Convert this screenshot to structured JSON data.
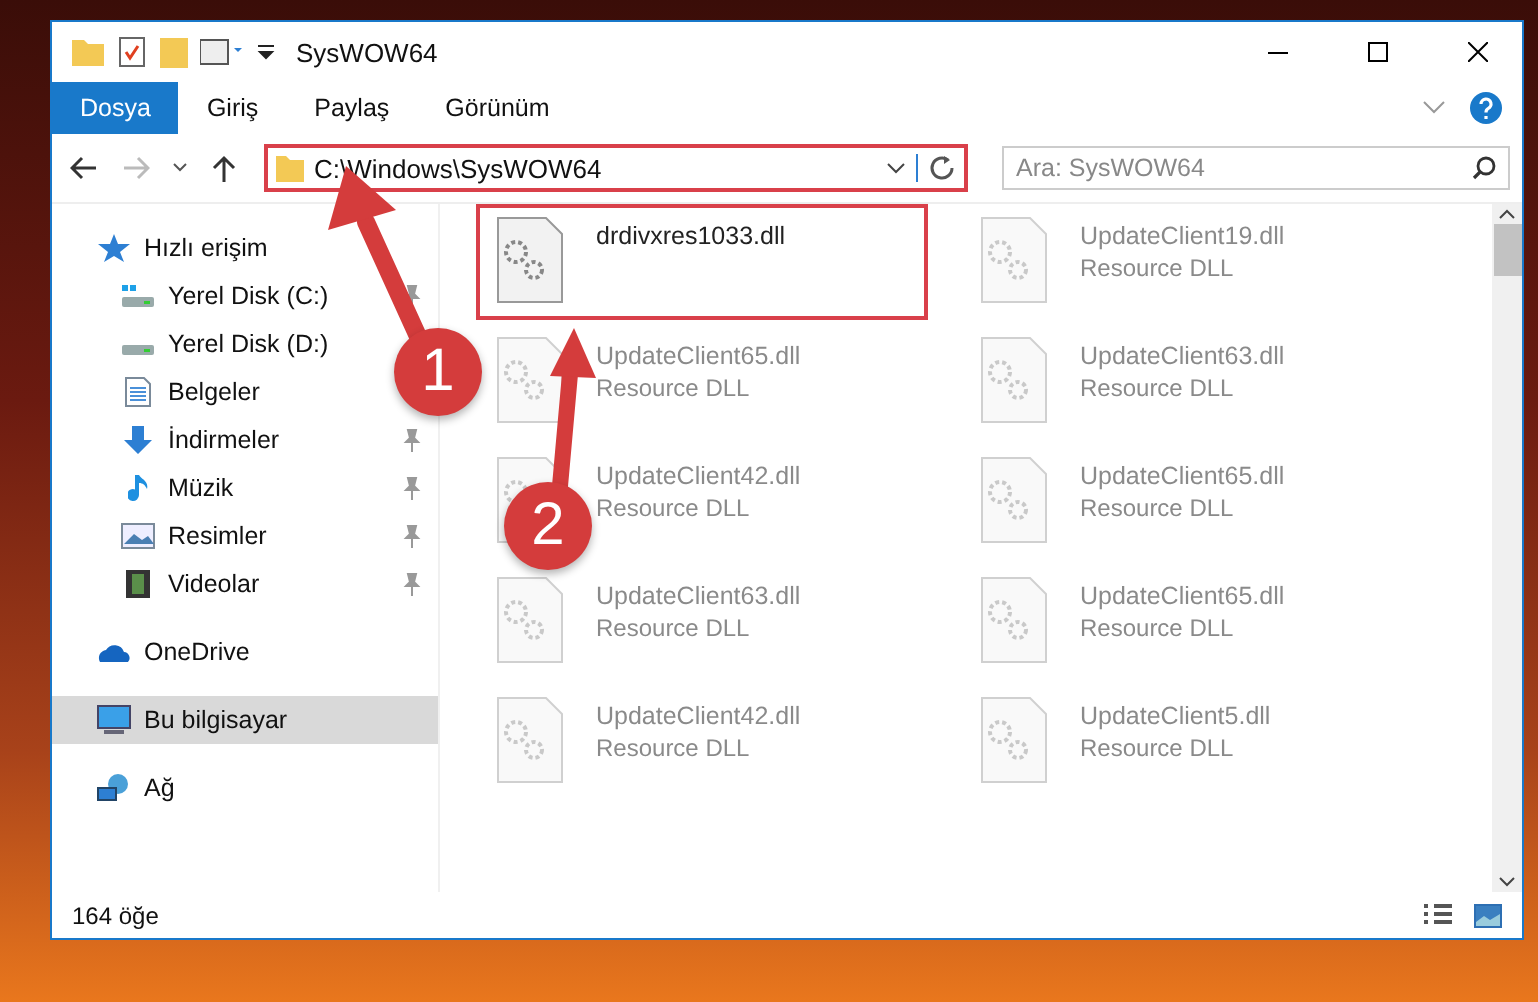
{
  "window": {
    "title": "SysWOW64"
  },
  "ribbon_tabs": [
    {
      "label": "Dosya",
      "selected": true
    },
    {
      "label": "Giriş",
      "selected": false
    },
    {
      "label": "Paylaş",
      "selected": false
    },
    {
      "label": "Görünüm",
      "selected": false
    }
  ],
  "address": {
    "path": "C:\\Windows\\SysWOW64",
    "highlighted": true
  },
  "search": {
    "placeholder": "Ara: SysWOW64"
  },
  "sidebar": {
    "items": [
      {
        "label": "Hızlı erişim",
        "kind": "star",
        "selected": false,
        "pinned": false,
        "children": [
          {
            "label": "Yerel Disk (C:)",
            "kind": "system-drive",
            "selected": false,
            "pinned": true
          },
          {
            "label": "Yerel Disk (D:)",
            "kind": "drive",
            "selected": false,
            "pinned": false
          },
          {
            "label": "Belgeler",
            "kind": "documents",
            "selected": false,
            "pinned": false
          },
          {
            "label": "İndirmeler",
            "kind": "downloads",
            "selected": false,
            "pinned": true
          },
          {
            "label": "Müzik",
            "kind": "music",
            "selected": false,
            "pinned": true
          },
          {
            "label": "Resimler",
            "kind": "pictures",
            "selected": false,
            "pinned": true
          },
          {
            "label": "Videolar",
            "kind": "videos",
            "selected": false,
            "pinned": true
          }
        ]
      },
      {
        "label": "OneDrive",
        "kind": "cloud",
        "selected": false,
        "pinned": false
      },
      {
        "label": "Bu bilgisayar",
        "kind": "computer",
        "selected": true,
        "pinned": false
      },
      {
        "label": "Ağ",
        "kind": "network",
        "selected": false,
        "pinned": false
      }
    ]
  },
  "files": [
    {
      "name": "drdivxres1033.dll",
      "highlighted": true,
      "faded": false
    },
    {
      "name": "UpdateClient19.dll",
      "type": "Resource DLL",
      "highlighted": false,
      "faded": true
    },
    {
      "name": "UpdateClient65.dll",
      "type": "Resource DLL",
      "highlighted": false,
      "faded": true
    },
    {
      "name": "UpdateClient63.dll",
      "type": "Resource DLL",
      "highlighted": false,
      "faded": true
    },
    {
      "name": "UpdateClient42.dll",
      "type": "Resource DLL",
      "highlighted": false,
      "faded": true
    },
    {
      "name": "UpdateClient65.dll",
      "type": "Resource DLL",
      "highlighted": false,
      "faded": true
    },
    {
      "name": "UpdateClient63.dll",
      "type": "Resource DLL",
      "highlighted": false,
      "faded": true
    },
    {
      "name": "UpdateClient65.dll",
      "type": "Resource DLL",
      "highlighted": false,
      "faded": true
    },
    {
      "name": "UpdateClient42.dll",
      "type": "Resource DLL",
      "highlighted": false,
      "faded": true
    },
    {
      "name": "UpdateClient5.dll",
      "type": "Resource DLL",
      "highlighted": false,
      "faded": true
    }
  ],
  "callouts": [
    {
      "number": "1"
    },
    {
      "number": "2"
    }
  ],
  "status_bar": {
    "item_count": "164 öğe"
  }
}
